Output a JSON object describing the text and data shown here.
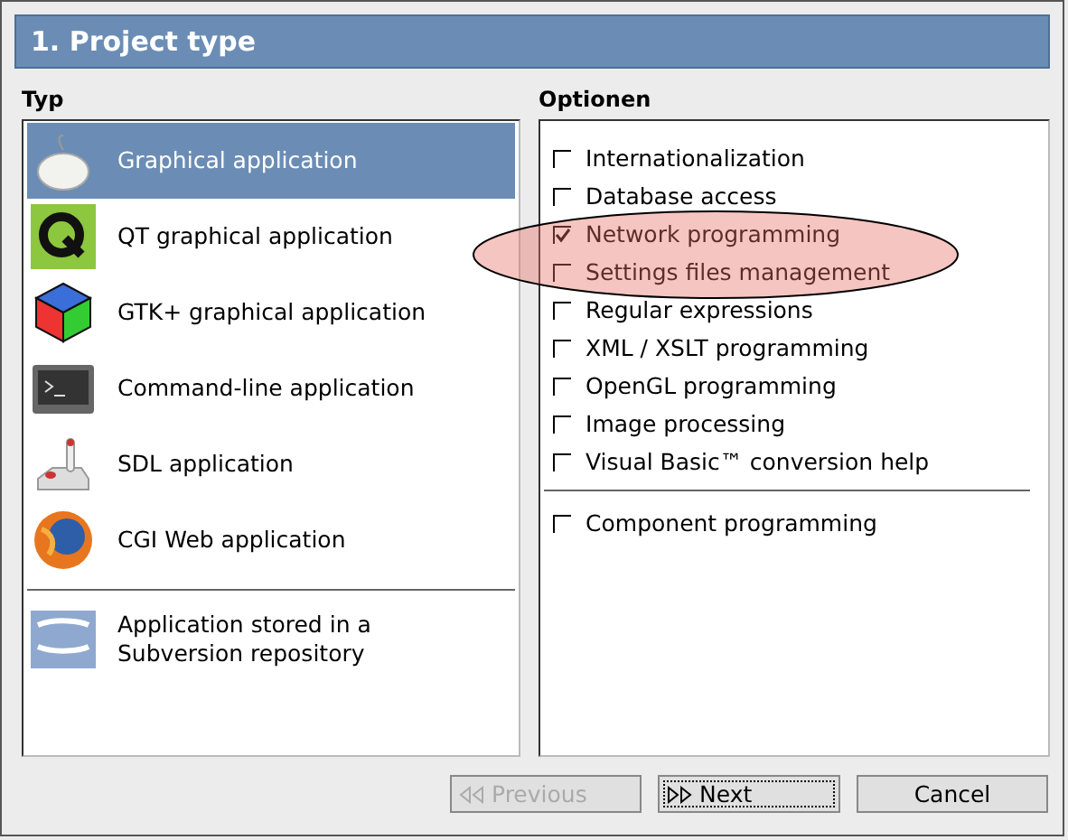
{
  "window": {
    "title": "1. Project type"
  },
  "type_panel": {
    "heading": "Typ",
    "groups": [
      {
        "items": [
          {
            "label": "Graphical application",
            "kind": "mouse",
            "selected": true
          },
          {
            "label": "QT graphical application",
            "kind": "qt",
            "selected": false
          },
          {
            "label": "GTK+ graphical application",
            "kind": "cube",
            "selected": false
          },
          {
            "label": "Command-line application",
            "kind": "terminal",
            "selected": false
          },
          {
            "label": "SDL application",
            "kind": "joystick",
            "selected": false
          },
          {
            "label": "CGI Web application",
            "kind": "globe",
            "selected": false
          }
        ]
      },
      {
        "items": [
          {
            "label": "Application stored in a Subversion repository",
            "kind": "svn",
            "selected": false
          }
        ]
      }
    ]
  },
  "options_panel": {
    "heading": "Optionen",
    "groups": [
      {
        "items": [
          {
            "label": "Internationalization",
            "checked": false
          },
          {
            "label": "Database access",
            "checked": false
          },
          {
            "label": "Network programming",
            "checked": true
          },
          {
            "label": "Settings files management",
            "checked": false
          },
          {
            "label": "Regular expressions",
            "checked": false
          },
          {
            "label": "XML / XSLT programming",
            "checked": false
          },
          {
            "label": "OpenGL programming",
            "checked": false
          },
          {
            "label": "Image processing",
            "checked": false
          },
          {
            "label": "Visual Basic™ conversion help",
            "checked": false
          }
        ]
      },
      {
        "items": [
          {
            "label": "Component programming",
            "checked": false
          }
        ]
      }
    ]
  },
  "buttons": [
    {
      "label": "Previous",
      "kind": "back",
      "disabled": true,
      "focused": false
    },
    {
      "label": "Next",
      "kind": "forward",
      "disabled": false,
      "focused": true
    },
    {
      "label": "Cancel",
      "kind": "plain",
      "disabled": false,
      "focused": false
    }
  ]
}
